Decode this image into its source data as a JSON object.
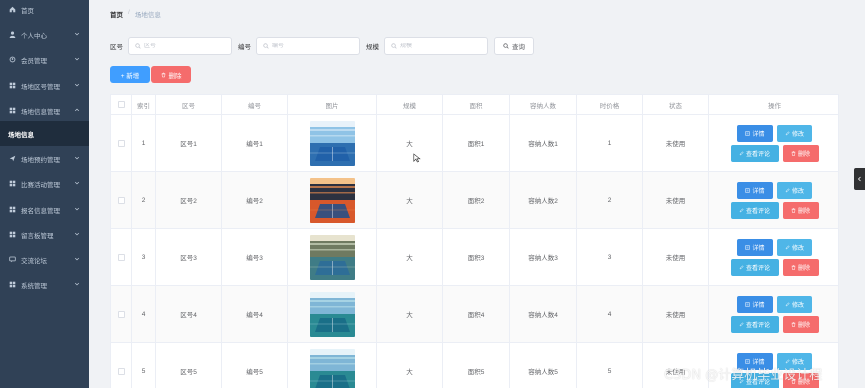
{
  "sidebar": {
    "items": [
      {
        "label": "首页",
        "icon": "home-icon"
      },
      {
        "label": "个人中心",
        "icon": "user-icon"
      },
      {
        "label": "会员管理",
        "icon": "person-icon"
      },
      {
        "label": "场地区号管理",
        "icon": "grid-icon"
      },
      {
        "label": "场地信息管理",
        "icon": "grid-icon"
      },
      {
        "label": "场地信息",
        "icon": ""
      },
      {
        "label": "场地预约管理",
        "icon": "send-icon"
      },
      {
        "label": "比赛活动管理",
        "icon": "grid-icon"
      },
      {
        "label": "报名信息管理",
        "icon": "grid-icon"
      },
      {
        "label": "留言板管理",
        "icon": "grid-icon"
      },
      {
        "label": "交流论坛",
        "icon": "chat-icon"
      },
      {
        "label": "系统管理",
        "icon": "grid-icon"
      }
    ]
  },
  "breadcrumb": {
    "home": "首页",
    "separator": "/",
    "current": "场地信息"
  },
  "search": {
    "area_label": "区号",
    "area_placeholder": "区号",
    "code_label": "编号",
    "code_placeholder": "编号",
    "size_label": "规模",
    "size_placeholder": "规模",
    "query_label": "查询"
  },
  "actions": {
    "add_label": "+ 新增",
    "delete_label": "删除"
  },
  "table": {
    "headers": [
      "索引",
      "区号",
      "编号",
      "图片",
      "规模",
      "面积",
      "容纳人数",
      "时价格",
      "状态",
      "操作"
    ],
    "rows": [
      {
        "index": "1",
        "area": "区号1",
        "code": "编号1",
        "size": "大",
        "sqm": "面积1",
        "capacity": "容纳人数1",
        "price": "1",
        "status": "未使用",
        "photo": "gym-hall-blue"
      },
      {
        "index": "2",
        "area": "区号2",
        "code": "编号2",
        "size": "大",
        "sqm": "面积2",
        "capacity": "容纳人数2",
        "price": "2",
        "status": "未使用",
        "photo": "gym-hall-orange"
      },
      {
        "index": "3",
        "area": "区号3",
        "code": "编号3",
        "size": "大",
        "sqm": "面积3",
        "capacity": "容纳人数3",
        "price": "3",
        "status": "未使用",
        "photo": "gym-hall-court"
      },
      {
        "index": "4",
        "area": "区号4",
        "code": "编号4",
        "size": "大",
        "sqm": "面积4",
        "capacity": "容纳人数4",
        "price": "4",
        "status": "未使用",
        "photo": "gym-hall-teal"
      },
      {
        "index": "5",
        "area": "区号5",
        "code": "编号5",
        "size": "大",
        "sqm": "面积5",
        "capacity": "容纳人数5",
        "price": "5",
        "status": "未使用",
        "photo": "gym-hall-teal"
      }
    ],
    "ops": {
      "detail": "详情",
      "edit": "修改",
      "review": "查看评论",
      "remove": "删除"
    }
  },
  "watermark": "CSDN @计算机毕业设计程",
  "colors": {
    "sidebar": "#304156",
    "primary": "#409eff",
    "danger": "#f56c6c",
    "info": "#4fb6e8"
  }
}
